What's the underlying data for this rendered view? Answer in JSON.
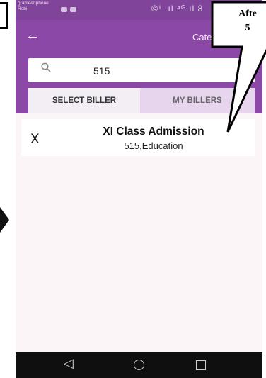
{
  "status_bar": {
    "carrier_line1": "grameenphone",
    "carrier_line2": "Robi",
    "signal_text": "©¹ .ıl ⁴ᴳ.ıl 8"
  },
  "app_bar": {
    "back_icon": "arrow-left-icon",
    "title": "Catego"
  },
  "search": {
    "value": "515",
    "clear_label": "✕"
  },
  "tabs": [
    {
      "label": "SELECT BILLER",
      "active": true
    },
    {
      "label": "MY BILLERS",
      "active": false
    }
  ],
  "result": {
    "marker": "X",
    "title": "XI Class Admission",
    "subtitle": "515,Education"
  },
  "nav": {
    "back_label": "◁"
  },
  "callout": {
    "line1": "Afte",
    "line2": "5"
  },
  "colors": {
    "primary": "#8c48a6",
    "status_bar": "#80449a",
    "background": "#fbf5f8",
    "nav_bar": "#0f0f0f"
  }
}
